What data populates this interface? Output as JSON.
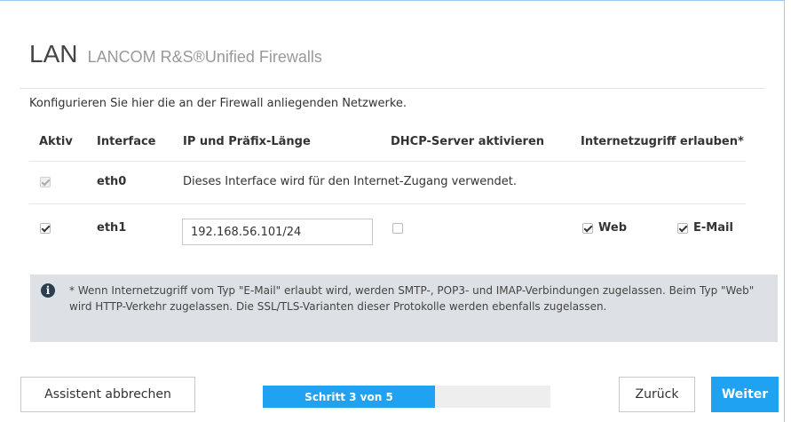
{
  "header": {
    "title": "LAN",
    "subtitle": "LANCOM R&S®Unified Firewalls"
  },
  "intro": "Konfigurieren Sie hier die an der Firewall anliegenden Netzwerke.",
  "table": {
    "columns": [
      "Aktiv",
      "Interface",
      "IP und Präfix-Länge",
      "DHCP-Server aktivieren",
      "Internetzugriff erlauben*"
    ],
    "rows": [
      {
        "active": true,
        "active_disabled": true,
        "interface": "eth0",
        "note": "Dieses Interface wird für den Internet-Zugang verwendet."
      },
      {
        "active": true,
        "interface": "eth1",
        "ip": "192.168.56.101/24",
        "dhcp": false,
        "web_label": "Web",
        "web": true,
        "email_label": "E-Mail",
        "email": true
      }
    ]
  },
  "info": {
    "icon": "info-icon",
    "text": "* Wenn Internetzugriff vom Typ \"E-Mail\" erlaubt wird, werden SMTP-, POP3- und IMAP-Verbindungen zugelassen. Beim Typ \"Web\" wird HTTP-Verkehr zugelassen. Die SSL/TLS-Varianten dieser Protokolle werden ebenfalls zugelassen."
  },
  "footer": {
    "cancel_label": "Assistent abbrechen",
    "progress_label": "Schritt 3 von 5",
    "progress_fraction": 0.6,
    "back_label": "Zurück",
    "next_label": "Weiter"
  },
  "colors": {
    "accent": "#1fa2f1",
    "info_bg": "#dde1e6",
    "border": "#9ec9ee"
  }
}
